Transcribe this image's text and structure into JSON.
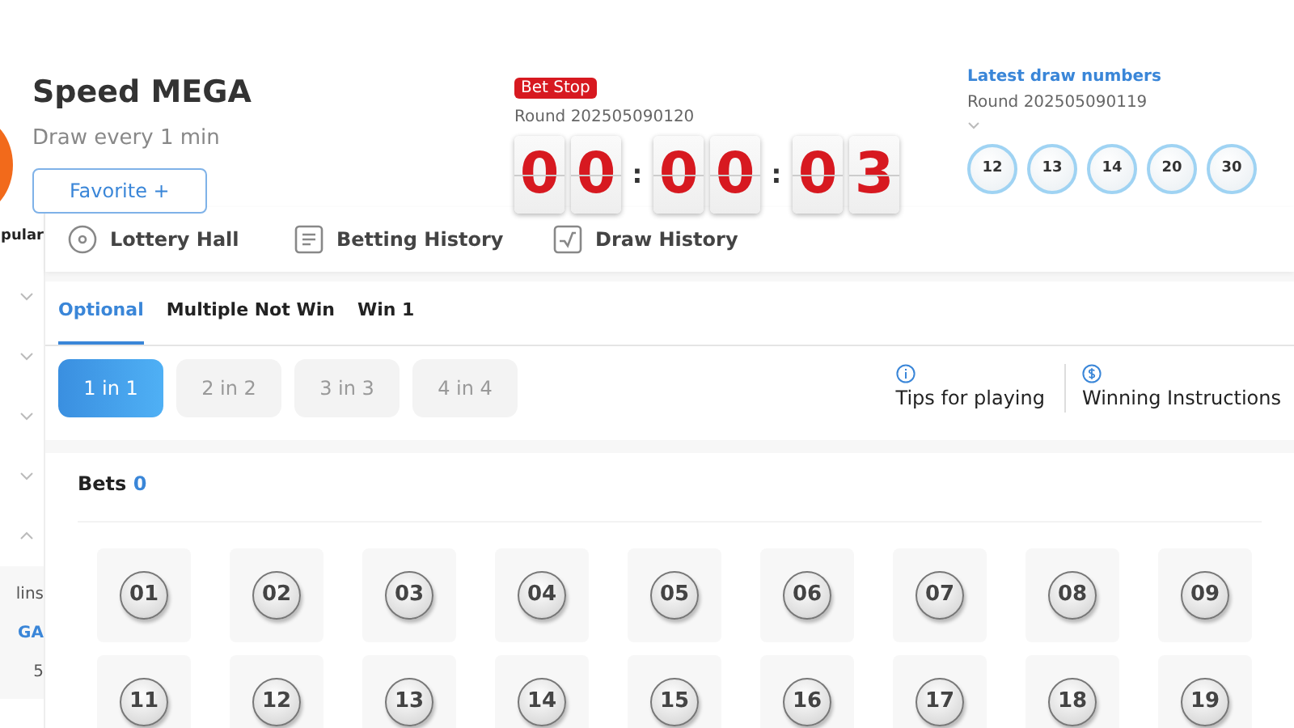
{
  "header": {
    "title": "Speed MEGA",
    "subtitle": "Draw every 1 min",
    "favorite_button": "Favorite +"
  },
  "countdown": {
    "status": "Bet Stop",
    "round": "Round 202505090120",
    "digits": [
      "0",
      "0",
      "0",
      "0",
      "0",
      "3"
    ],
    "separators": [
      ":",
      ":"
    ]
  },
  "latest_draw": {
    "title": "Latest draw numbers",
    "round": "Round 202505090119",
    "numbers": [
      "12",
      "13",
      "14",
      "20",
      "30"
    ]
  },
  "sidebar": {
    "items": [
      {
        "kind": "heading",
        "label": "pular"
      },
      {
        "kind": "chevron",
        "expanded": false
      },
      {
        "kind": "chevron",
        "expanded": false
      },
      {
        "kind": "chevron",
        "expanded": false
      },
      {
        "kind": "chevron",
        "expanded": false
      },
      {
        "kind": "chevron",
        "expanded": true
      }
    ],
    "sub_items": [
      {
        "label": "lins",
        "selected": false
      },
      {
        "label": "GA",
        "selected": true
      },
      {
        "label": "5",
        "selected": false
      }
    ]
  },
  "nav_tabs": [
    {
      "kind": "target",
      "label": "Lottery Hall"
    },
    {
      "kind": "list",
      "label": "Betting History"
    },
    {
      "kind": "chart",
      "label": "Draw History"
    }
  ],
  "play_tabs": [
    {
      "label": "Optional",
      "selected": true
    },
    {
      "label": "Multiple Not Win",
      "selected": false
    },
    {
      "label": "Win 1",
      "selected": false
    }
  ],
  "modes": [
    {
      "label": "1 in 1",
      "selected": true
    },
    {
      "label": "2 in 2",
      "selected": false
    },
    {
      "label": "3 in 3",
      "selected": false
    },
    {
      "label": "4 in 4",
      "selected": false
    }
  ],
  "info_links": [
    {
      "kind": "info",
      "label": "Tips for playing"
    },
    {
      "kind": "dollar",
      "label": "Winning Instructions"
    }
  ],
  "bets": {
    "label": "Bets",
    "count": "0"
  },
  "number_rows": [
    [
      "01",
      "02",
      "03",
      "04",
      "05",
      "06",
      "07",
      "08",
      "09"
    ],
    [
      "11",
      "12",
      "13",
      "14",
      "15",
      "16",
      "17",
      "18",
      "19"
    ]
  ]
}
